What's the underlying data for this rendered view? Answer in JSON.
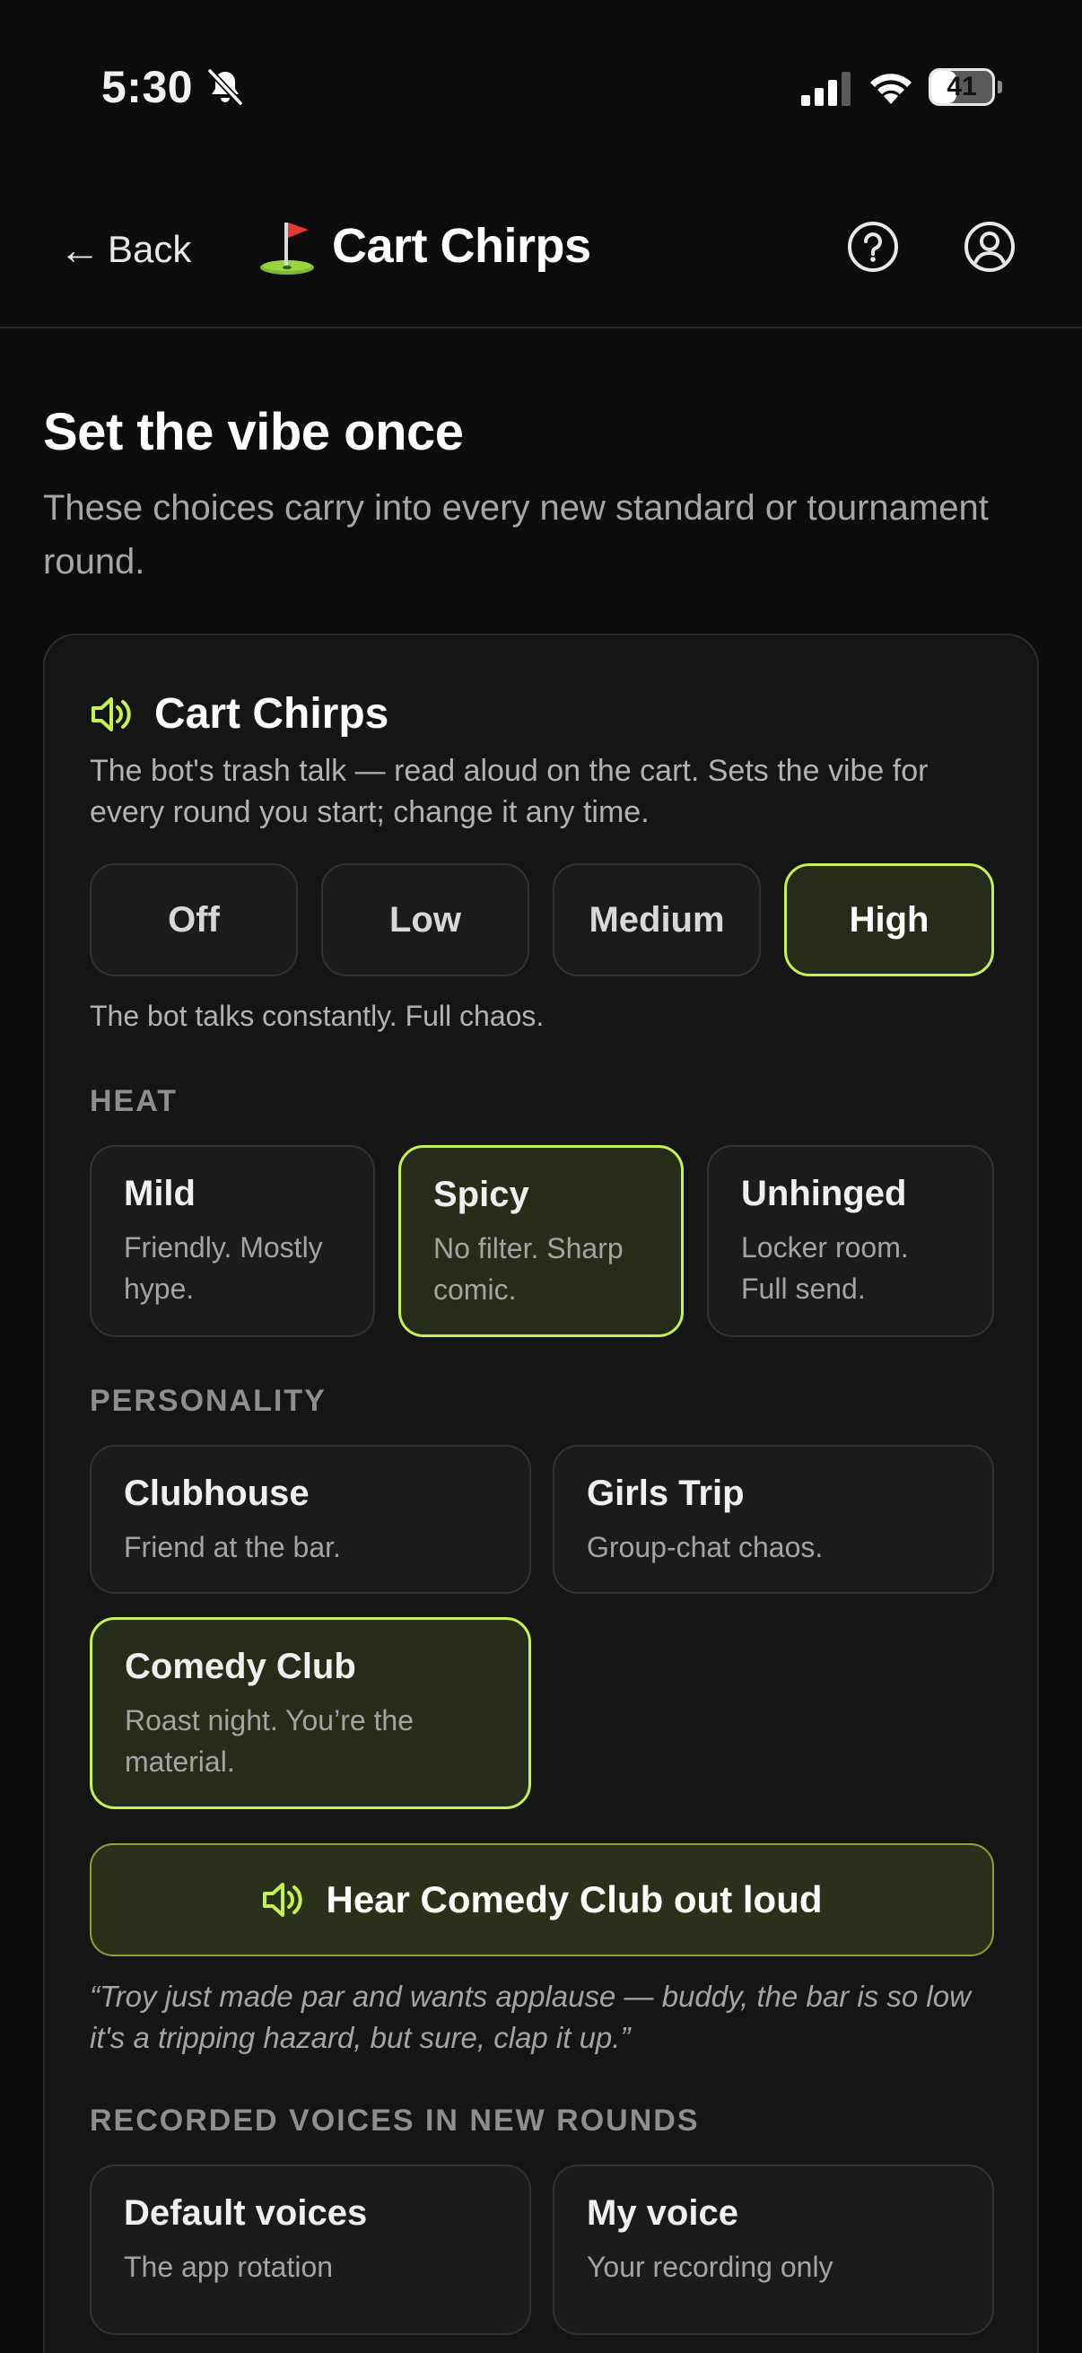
{
  "status_bar": {
    "time": "5:30",
    "battery": "41",
    "battery_level": 0.41
  },
  "header": {
    "back_label": "Back",
    "title": "Cart Chirps",
    "flag_icon": "golf-flag-icon"
  },
  "intro": {
    "title": "Set the vibe once",
    "subtitle": "These choices carry into every new standard or tournament round."
  },
  "card": {
    "title": "Cart Chirps",
    "description": "The bot's trash talk — read aloud on the cart. Sets the vibe for every round you start; change it any time.",
    "levels": [
      "Off",
      "Low",
      "Medium",
      "High"
    ],
    "selected_level": "High",
    "level_description": "The bot talks constantly. Full chaos.",
    "heat": {
      "label": "HEAT",
      "options": [
        {
          "title": "Mild",
          "desc": "Friendly. Mostly hype."
        },
        {
          "title": "Spicy",
          "desc": "No filter. Sharp comic."
        },
        {
          "title": "Unhinged",
          "desc": "Locker room. Full send."
        }
      ],
      "selected": "Spicy"
    },
    "personality": {
      "label": "PERSONALITY",
      "options": [
        {
          "title": "Clubhouse",
          "desc": "Friend at the bar."
        },
        {
          "title": "Girls Trip",
          "desc": "Group-chat chaos."
        },
        {
          "title": "Comedy Club",
          "desc": "Roast night. You’re the material."
        }
      ],
      "selected": "Comedy Club"
    },
    "hear_button": "Hear Comedy Club out loud",
    "quote": "“Troy just made par and wants applause — buddy, the bar is so low it's a tripping hazard, but sure, clap it up.”",
    "voices": {
      "label": "RECORDED VOICES IN NEW ROUNDS",
      "options": [
        {
          "title": "Default voices",
          "desc": "The app rotation"
        },
        {
          "title": "My voice",
          "desc": "Your recording only"
        }
      ]
    }
  },
  "colors": {
    "accent": "#c6f24e",
    "background": "#0c0c0d",
    "card": "#151516"
  }
}
